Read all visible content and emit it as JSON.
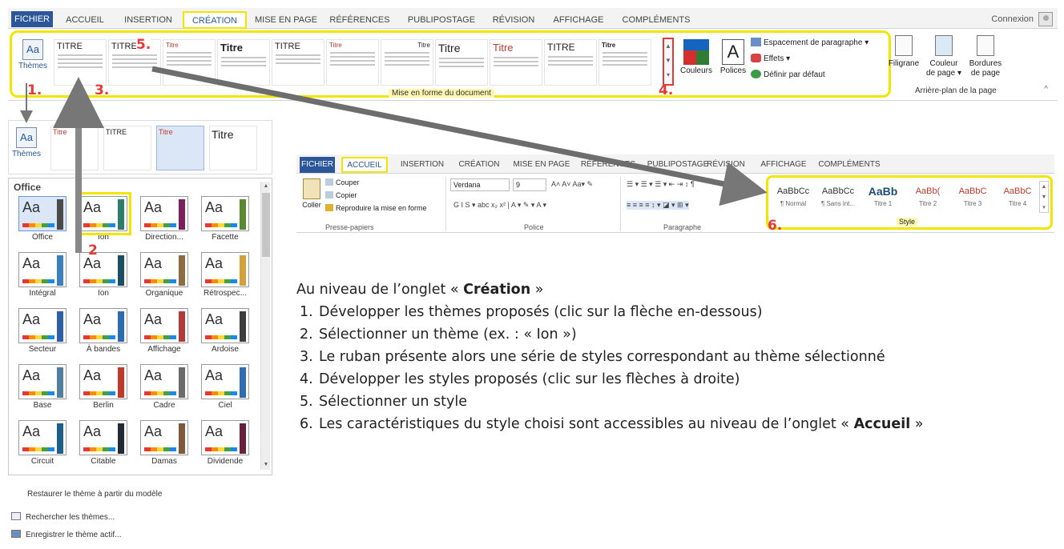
{
  "ribbon1": {
    "tabs": [
      "FICHIER",
      "ACCUEIL",
      "INSERTION",
      "CRÉATION",
      "MISE EN PAGE",
      "RÉFÉRENCES",
      "PUBLIPOSTAGE",
      "RÉVISION",
      "AFFICHAGE",
      "COMPLÉMENTS"
    ],
    "connexion": "Connexion",
    "themes_label": "Thèmes",
    "style_previews": [
      "TITRE",
      "TITRE",
      "Titre",
      "Titre",
      "TITRE",
      "Titre",
      "Titre",
      "Titre",
      "Titre",
      "TITRE",
      "Titre"
    ],
    "group_label": "Mise en forme du document",
    "couleurs": "Couleurs",
    "polices": "Polices",
    "espacement": "Espacement de paragraphe ▾",
    "effets": "Effets ▾",
    "definir": "Définir par défaut",
    "filigrane": "Filigrane",
    "couleur_page_1": "Couleur",
    "couleur_page_2": "de page ▾",
    "bordures_1": "Bordures",
    "bordures_2": "de page",
    "page_bg_label": "Arrière-plan de la page",
    "collapse": "^"
  },
  "callouts": {
    "n1": "1.",
    "n2": "2",
    "n3": "3.",
    "n4": "4.",
    "n5": "5.",
    "n6": "6."
  },
  "gallery": {
    "themes_label": "Thèmes",
    "previews": [
      "Titre",
      "TITRE",
      "Titre",
      "Titre"
    ],
    "section": "Office",
    "tiles": [
      {
        "name": "Office",
        "bar": "#4a4a4a"
      },
      {
        "name": "Ion",
        "bar": "#2e7d6b"
      },
      {
        "name": "Direction...",
        "bar": "#7b1f5e"
      },
      {
        "name": "Facette",
        "bar": "#5a8a2f"
      },
      {
        "name": "Intégral",
        "bar": "#3c7fc0"
      },
      {
        "name": "Ion",
        "bar": "#1b4e63"
      },
      {
        "name": "Organique",
        "bar": "#8d6b3e"
      },
      {
        "name": "Rétrospec...",
        "bar": "#d4a03a"
      },
      {
        "name": "Secteur",
        "bar": "#2d5ea8"
      },
      {
        "name": "À bandes",
        "bar": "#2b6cb0"
      },
      {
        "name": "Affichage",
        "bar": "#b33a3a"
      },
      {
        "name": "Ardoise",
        "bar": "#3d3d3d"
      },
      {
        "name": "Base",
        "bar": "#4f7f9d"
      },
      {
        "name": "Berlin",
        "bar": "#c0392b"
      },
      {
        "name": "Cadre",
        "bar": "#6b6b6b"
      },
      {
        "name": "Ciel",
        "bar": "#2f6db5"
      },
      {
        "name": "Circuit",
        "bar": "#1d5f8a"
      },
      {
        "name": "Citable",
        "bar": "#222a38"
      },
      {
        "name": "Damas",
        "bar": "#7f5a3a"
      },
      {
        "name": "Dividende",
        "bar": "#6a1f3a"
      }
    ],
    "cmd_restore": "Restaurer le thème à partir du modèle",
    "cmd_search": "Rechercher les thèmes...",
    "cmd_save": "Enregistrer le thème actif..."
  },
  "ribbon2": {
    "tabs": [
      "FICHIER",
      "ACCUEIL",
      "INSERTION",
      "CRÉATION",
      "MISE EN PAGE",
      "RÉFÉRENCES",
      "PUBLIPOSTAGE",
      "RÉVISION",
      "AFFICHAGE",
      "COMPLÉMENTS"
    ],
    "coller": "Coller",
    "couper": "Couper",
    "copier": "Copier",
    "reproduire": "Reproduire la mise en forme",
    "presse_papiers": "Presse-papiers",
    "font_name": "Verdana",
    "font_size": "9",
    "police": "Police",
    "paragraphe": "Paragraphe",
    "style_group": "Style",
    "quick_styles": [
      {
        "sample": "AaBbCc",
        "name": "¶ Normal",
        "color": "#333333"
      },
      {
        "sample": "AaBbCc",
        "name": "¶ Sans int...",
        "color": "#333333"
      },
      {
        "sample": "AaBb",
        "name": "Titre 1",
        "color": "#1f4e79"
      },
      {
        "sample": "AaBb(",
        "name": "Titre 2",
        "color": "#c0392b"
      },
      {
        "sample": "AaBbC",
        "name": "Titre 3",
        "color": "#c0392b"
      },
      {
        "sample": "AaBbC",
        "name": "Titre 4",
        "color": "#c0392b"
      }
    ]
  },
  "instructions": {
    "intro_pre": "Au niveau de l’onglet « ",
    "intro_bold": "Création",
    "intro_post": " »",
    "steps": [
      {
        "n": "1.",
        "text": "Développer les thèmes proposés (clic sur la flèche en-dessous)"
      },
      {
        "n": "2.",
        "text": "Sélectionner un thème (ex. : « Ion »)"
      },
      {
        "n": "3.",
        "text": "Le ruban présente alors une série de styles correspondant au thème sélectionné"
      },
      {
        "n": "4.",
        "text": "Développer les styles proposés (clic sur les flèches à droite)"
      },
      {
        "n": "5.",
        "text": "Sélectionner un style"
      },
      {
        "n": "6.",
        "text": "Les caractéristiques du style choisi sont accessibles au niveau de l’onglet « ",
        "bold": "Accueil",
        "post": " »"
      }
    ]
  },
  "colors": {
    "accent": "#2b579a",
    "highlight": "#f2e600",
    "callout": "#e53935",
    "arrow": "#777777"
  }
}
